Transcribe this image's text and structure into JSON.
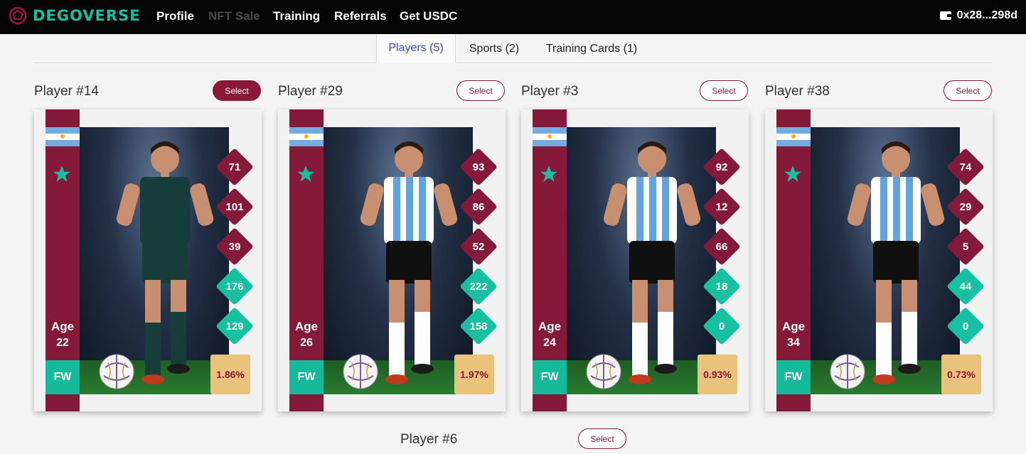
{
  "nav": {
    "logo_text": "DEGOVERSE",
    "links": [
      {
        "label": "Profile",
        "dim": false
      },
      {
        "label": "NFT Sale",
        "dim": true
      },
      {
        "label": "Training",
        "dim": false
      },
      {
        "label": "Referrals",
        "dim": false
      },
      {
        "label": "Get USDC",
        "dim": false
      }
    ],
    "wallet": "0x28...298d"
  },
  "tabs": [
    {
      "label": "Players (5)",
      "active": true
    },
    {
      "label": "Sports (2)",
      "active": false
    },
    {
      "label": "Training Cards (1)",
      "active": false
    }
  ],
  "cards": [
    {
      "title": "Player #14",
      "select_label": "Select",
      "selected": true,
      "age_label": "Age",
      "age": "22",
      "position": "FW",
      "stats": [
        "71",
        "101",
        "39",
        "176",
        "129"
      ],
      "pct": "1.86%",
      "kit": "dark"
    },
    {
      "title": "Player #29",
      "select_label": "Select",
      "selected": false,
      "age_label": "Age",
      "age": "26",
      "position": "FW",
      "stats": [
        "93",
        "86",
        "52",
        "222",
        "158"
      ],
      "pct": "1.97%",
      "kit": "striped"
    },
    {
      "title": "Player #3",
      "select_label": "Select",
      "selected": false,
      "age_label": "Age",
      "age": "24",
      "position": "FW",
      "stats": [
        "92",
        "12",
        "66",
        "18",
        "0"
      ],
      "pct": "0.93%",
      "kit": "striped"
    },
    {
      "title": "Player #38",
      "select_label": "Select",
      "selected": false,
      "age_label": "Age",
      "age": "34",
      "position": "FW",
      "stats": [
        "74",
        "29",
        "5",
        "44",
        "0"
      ],
      "pct": "0.73%",
      "kit": "striped"
    }
  ],
  "next_card": {
    "title": "Player #6",
    "select_label": "Select"
  },
  "colors": {
    "accent": "#85193a",
    "teal": "#17c0a0",
    "gold": "#e9c37c",
    "tab_active": "#3a4fbf"
  }
}
